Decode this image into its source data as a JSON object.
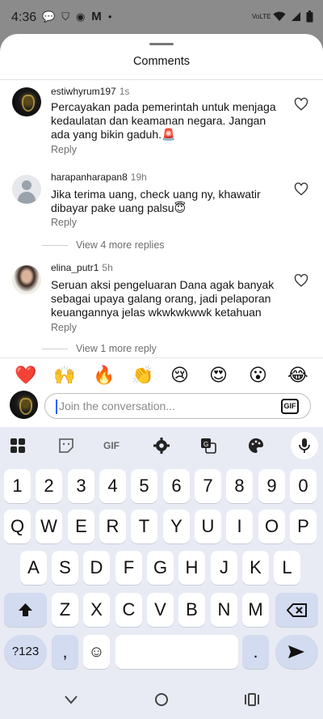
{
  "status_bar": {
    "time": "4:36",
    "volte_label": "VoLTE"
  },
  "sheet": {
    "title": "Comments"
  },
  "comments": [
    {
      "username": "estiwhyrum197",
      "time": "1s",
      "text": "Percayakan pada pemerintah untuk menjaga kedaulatan dan keamanan negara. Jangan ada yang bikin gaduh.🚨",
      "reply_label": "Reply"
    },
    {
      "username": "harapanharapan8",
      "time": "19h",
      "text": "Jika terima uang, check uang ny, khawatir dibayar pake uang palsu😇",
      "reply_label": "Reply",
      "more_replies": "View 4 more replies"
    },
    {
      "username": "elina_putr1",
      "time": "5h",
      "text": "Seruan aksi pengeluaran Dana agak banyak sebagai upaya galang orang, jadi pelaporan keuangannya jelas wkwkwkwwk ketahuan",
      "reply_label": "Reply",
      "more_replies": "View 1 more reply"
    }
  ],
  "reactions": [
    "❤️",
    "🙌",
    "🔥",
    "👏",
    "😢",
    "😍",
    "😮",
    "😂"
  ],
  "input": {
    "placeholder": "Join the conversation...",
    "gif_label": "GIF"
  },
  "keyboard": {
    "toolbar": {
      "gif_label": "GIF"
    },
    "rows": [
      [
        "1",
        "2",
        "3",
        "4",
        "5",
        "6",
        "7",
        "8",
        "9",
        "0"
      ],
      [
        "Q",
        "W",
        "E",
        "R",
        "T",
        "Y",
        "U",
        "I",
        "O",
        "P"
      ],
      [
        "A",
        "S",
        "D",
        "F",
        "G",
        "H",
        "J",
        "K",
        "L"
      ],
      [
        "Z",
        "X",
        "C",
        "V",
        "B",
        "N",
        "M"
      ]
    ],
    "symbols_label": "?123",
    "comma_label": ",",
    "emoji_label": "☺",
    "period_label": "."
  }
}
